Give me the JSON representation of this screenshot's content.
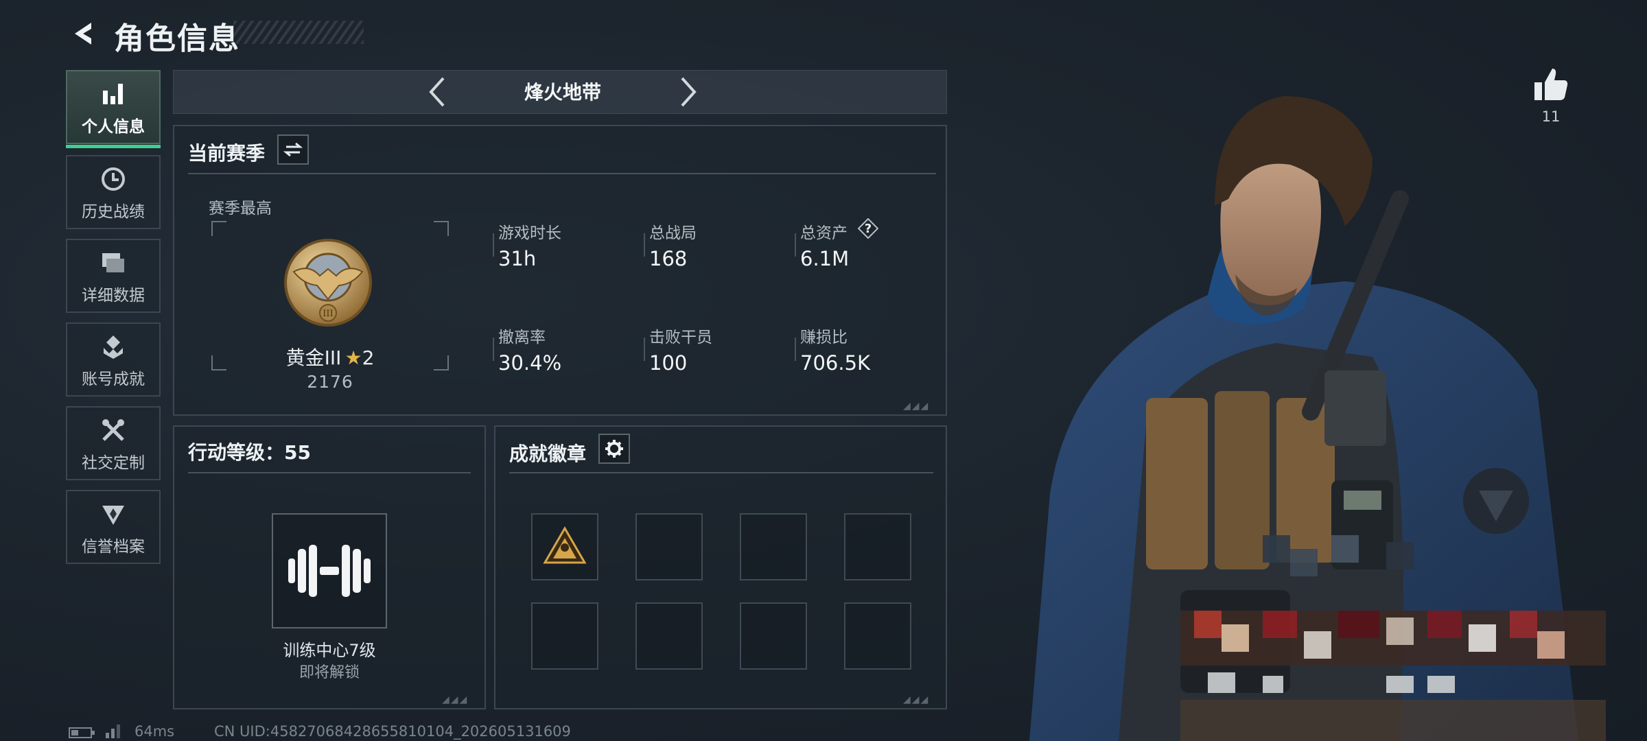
{
  "header": {
    "title": "角色信息"
  },
  "sidebar": {
    "items": [
      {
        "label": "个人信息",
        "icon": "bar-chart-icon",
        "active": true
      },
      {
        "label": "历史战绩",
        "icon": "clock-history-icon",
        "active": false
      },
      {
        "label": "详细数据",
        "icon": "folders-icon",
        "active": false
      },
      {
        "label": "账号成就",
        "icon": "achievement-icon",
        "active": false
      },
      {
        "label": "社交定制",
        "icon": "wrench-icon",
        "active": false
      },
      {
        "label": "信誉档案",
        "icon": "reputation-icon",
        "active": false
      }
    ]
  },
  "mode": {
    "title": "烽火地带"
  },
  "season": {
    "title": "当前赛季",
    "best_label": "赛季最高",
    "rank_name": "黄金III",
    "rank_stars": "2",
    "rank_score": "2176",
    "stats": [
      {
        "label": "游戏时长",
        "value": "31h"
      },
      {
        "label": "总战局",
        "value": "168"
      },
      {
        "label": "总资产",
        "value": "6.1M",
        "help": "?"
      },
      {
        "label": "撤离率",
        "value": "30.4%"
      },
      {
        "label": "击败干员",
        "value": "100"
      },
      {
        "label": "赚损比",
        "value": "706.5K"
      }
    ]
  },
  "level": {
    "title": "行动等级：55",
    "locked_title": "训练中心7级",
    "locked_sub": "即将解锁"
  },
  "badges": {
    "title": "成就徽章"
  },
  "like": {
    "count": "11"
  },
  "footer": {
    "ping": "64ms",
    "uid": "CN UID:45827068428655810104_202605131609"
  },
  "colors": {
    "accent": "#3fd08d",
    "gold": "#c9a15a",
    "background": "#1c242d"
  }
}
